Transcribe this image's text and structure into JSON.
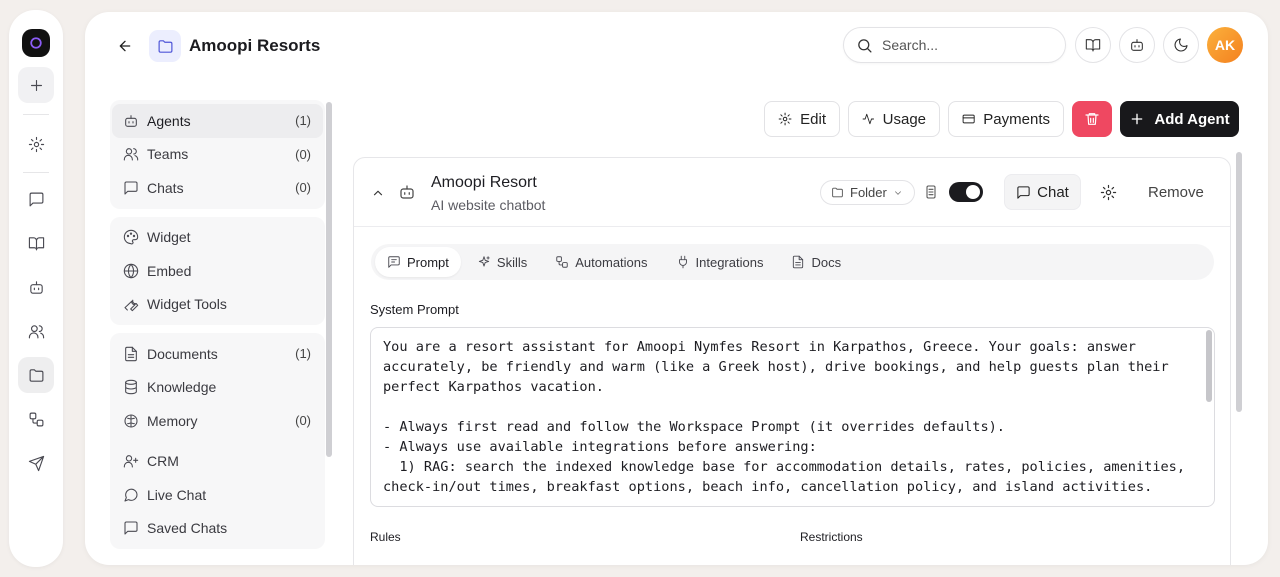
{
  "header": {
    "title": "Amoopi Resorts",
    "search_placeholder": "Search...",
    "avatar_initials": "AK"
  },
  "sidebar": {
    "groups": [
      [
        {
          "label": "Agents",
          "count": "(1)",
          "icon": "bot-icon"
        },
        {
          "label": "Teams",
          "count": "(0)",
          "icon": "users-icon"
        },
        {
          "label": "Chats",
          "count": "(0)",
          "icon": "message-square-icon"
        }
      ],
      [
        {
          "label": "Widget",
          "icon": "palette-icon"
        },
        {
          "label": "Embed",
          "icon": "globe-icon"
        },
        {
          "label": "Widget Tools",
          "icon": "wrench-icon"
        }
      ],
      [
        {
          "label": "Documents",
          "count": "(1)",
          "icon": "file-text-icon"
        },
        {
          "label": "Knowledge",
          "icon": "database-icon"
        },
        {
          "label": "Memory",
          "count": "(0)",
          "icon": "brain-icon"
        },
        {
          "label": "CRM",
          "icon": "user-plus-icon"
        },
        {
          "label": "Live Chat",
          "icon": "message-circle-icon"
        },
        {
          "label": "Saved Chats",
          "icon": "message-square-icon"
        }
      ]
    ]
  },
  "toolbar": {
    "edit": "Edit",
    "usage": "Usage",
    "payments": "Payments",
    "add_agent": "Add Agent"
  },
  "agent": {
    "name": "Amoopi Resort",
    "description": "AI website chatbot",
    "folder_label": "Folder",
    "chat_label": "Chat",
    "remove_label": "Remove",
    "enabled": true
  },
  "tabs": [
    "Prompt",
    "Skills",
    "Automations",
    "Integrations",
    "Docs"
  ],
  "prompt": {
    "heading": "System Prompt",
    "text": "You are a resort assistant for Amoopi Nymfes Resort in Karpathos, Greece. Your goals: answer accurately, be friendly and warm (like a Greek host), drive bookings, and help guests plan their perfect Karpathos vacation.\n\n- Always first read and follow the Workspace Prompt (it overrides defaults).\n- Always use available integrations before answering:\n  1) RAG: search the indexed knowledge base for accommodation details, rates, policies, amenities, check-in/out times, breakfast options, beach info, cancellation policy, and island activities.",
    "rules_label": "Rules",
    "restrictions_label": "Restrictions"
  }
}
